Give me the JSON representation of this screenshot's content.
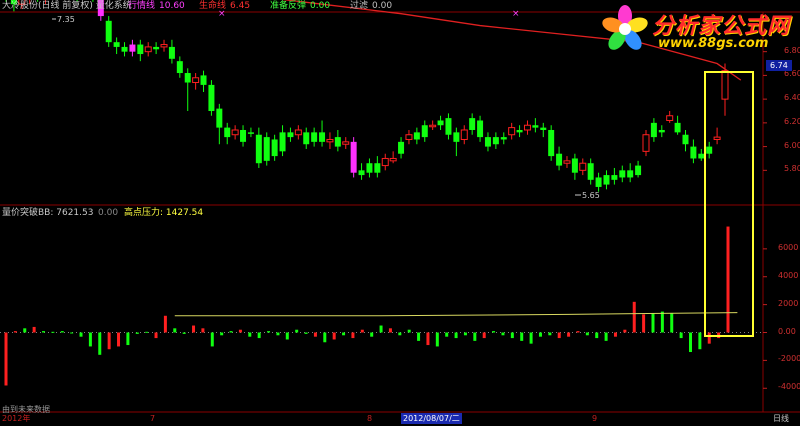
{
  "header": {
    "title": "大冷股份(日线 前复权) 量化系统",
    "items": [
      {
        "label": "行情线",
        "value": "10.60",
        "color": "#ff40ff"
      },
      {
        "label": "生命线",
        "value": "6.45",
        "color": "#ff3030"
      },
      {
        "label": "准备反弹",
        "value": "0.00",
        "color": "#40ff40"
      },
      {
        "label": "过滤",
        "value": "0.00",
        "color": "#c0c0c0"
      }
    ]
  },
  "price_panel": {
    "price_tag": "6.74",
    "y_ticks": [
      "6.80",
      "6.60",
      "6.40",
      "6.20",
      "6.00",
      "5.80"
    ],
    "high_marker": "7.35",
    "low_marker": "5.65"
  },
  "volume_panel": {
    "title": "量价突破",
    "bb_label": "BB: 7621.53",
    "bb_extra": "0.00",
    "pressure_label": "高点压力: 1427.54",
    "y_ticks": [
      "6000",
      "4000",
      "2000",
      "0.00",
      "-2000",
      "-4000"
    ],
    "footer_note": "由到未来数据"
  },
  "bottom_bar": {
    "dates": [
      "2012年",
      "7",
      "8",
      "2012/08/07/二",
      "9"
    ],
    "period": "日线"
  },
  "logo": {
    "title": "分析家公式网",
    "url": "www.88gs.com"
  },
  "colors": {
    "up": "#ff2020",
    "down": "#10ff10",
    "signal": "#ff30ff",
    "life_line": "#e02020",
    "pressure_line": "#d8d860",
    "highlight_box": "#ffff30",
    "grid": "#8a0000"
  },
  "chart_data": {
    "type": "candlestick",
    "ylim": [
      5.55,
      7.05
    ],
    "candles": [
      [
        7.32,
        7.28,
        7.36,
        7.22,
        "d"
      ],
      [
        7.26,
        7.2,
        7.3,
        7.14,
        "d"
      ],
      [
        7.2,
        7.26,
        7.3,
        7.16,
        "u"
      ],
      [
        7.24,
        7.32,
        7.36,
        7.2,
        "u"
      ],
      [
        7.3,
        7.26,
        7.35,
        7.22,
        "d"
      ],
      [
        7.26,
        7.32,
        7.35,
        7.2,
        "u"
      ],
      [
        7.36,
        7.4,
        7.42,
        7.3,
        "d"
      ],
      [
        7.38,
        7.28,
        7.42,
        7.24,
        "d"
      ],
      [
        7.28,
        7.34,
        7.38,
        7.24,
        "u"
      ],
      [
        7.34,
        7.28,
        7.38,
        7.22,
        "d"
      ],
      [
        7.3,
        7.36,
        7.4,
        7.26,
        "u"
      ],
      [
        7.36,
        7.28,
        7.4,
        7.22,
        "d"
      ],
      [
        7.28,
        7.1,
        7.32,
        7.06,
        "s"
      ],
      [
        7.06,
        6.88,
        7.1,
        6.84,
        "d"
      ],
      [
        6.88,
        6.84,
        6.92,
        6.78,
        "d"
      ],
      [
        6.84,
        6.8,
        6.88,
        6.76,
        "d"
      ],
      [
        6.8,
        6.86,
        6.9,
        6.76,
        "s"
      ],
      [
        6.86,
        6.78,
        6.9,
        6.72,
        "d"
      ],
      [
        6.8,
        6.84,
        6.88,
        6.76,
        "u"
      ],
      [
        6.84,
        6.82,
        6.88,
        6.78,
        "d"
      ],
      [
        6.84,
        6.86,
        6.9,
        6.8,
        "u"
      ],
      [
        6.84,
        6.74,
        6.9,
        6.7,
        "d"
      ],
      [
        6.72,
        6.62,
        6.76,
        6.58,
        "d"
      ],
      [
        6.62,
        6.54,
        6.66,
        6.3,
        "d"
      ],
      [
        6.54,
        6.58,
        6.62,
        6.48,
        "u"
      ],
      [
        6.6,
        6.52,
        6.64,
        6.46,
        "d"
      ],
      [
        6.52,
        6.3,
        6.56,
        6.26,
        "d"
      ],
      [
        6.32,
        6.16,
        6.36,
        6.02,
        "d"
      ],
      [
        6.16,
        6.08,
        6.2,
        6.02,
        "d"
      ],
      [
        6.1,
        6.14,
        6.18,
        6.06,
        "u"
      ],
      [
        6.14,
        6.04,
        6.18,
        6.0,
        "d"
      ],
      [
        6.12,
        6.12,
        6.16,
        6.08,
        "d"
      ],
      [
        6.1,
        5.86,
        6.16,
        5.82,
        "d"
      ],
      [
        5.88,
        6.08,
        6.12,
        5.84,
        "d"
      ],
      [
        6.06,
        5.92,
        6.1,
        5.88,
        "d"
      ],
      [
        5.96,
        6.12,
        6.18,
        5.92,
        "d"
      ],
      [
        6.12,
        6.08,
        6.16,
        6.04,
        "d"
      ],
      [
        6.1,
        6.14,
        6.18,
        6.06,
        "u"
      ],
      [
        6.12,
        6.02,
        6.16,
        5.98,
        "d"
      ],
      [
        6.04,
        6.12,
        6.16,
        6.0,
        "d"
      ],
      [
        6.12,
        6.04,
        6.22,
        6.0,
        "d"
      ],
      [
        6.04,
        6.06,
        6.12,
        5.98,
        "u"
      ],
      [
        6.08,
        6.0,
        6.14,
        5.96,
        "d"
      ],
      [
        6.02,
        6.04,
        6.08,
        5.98,
        "u"
      ],
      [
        6.04,
        5.78,
        6.08,
        5.74,
        "s"
      ],
      [
        5.8,
        5.76,
        5.86,
        5.72,
        "d"
      ],
      [
        5.78,
        5.86,
        5.9,
        5.74,
        "d"
      ],
      [
        5.86,
        5.78,
        5.92,
        5.74,
        "d"
      ],
      [
        5.84,
        5.9,
        5.94,
        5.8,
        "u"
      ],
      [
        5.9,
        5.88,
        5.96,
        5.86,
        "u"
      ],
      [
        5.94,
        6.04,
        6.08,
        5.9,
        "d"
      ],
      [
        6.06,
        6.1,
        6.14,
        6.02,
        "u"
      ],
      [
        6.12,
        6.06,
        6.16,
        6.02,
        "d"
      ],
      [
        6.08,
        6.18,
        6.22,
        6.04,
        "d"
      ],
      [
        6.18,
        6.18,
        6.22,
        6.14,
        "u"
      ],
      [
        6.18,
        6.22,
        6.26,
        6.14,
        "d"
      ],
      [
        6.24,
        6.1,
        6.28,
        6.06,
        "d"
      ],
      [
        6.12,
        6.04,
        6.16,
        5.92,
        "d"
      ],
      [
        6.06,
        6.14,
        6.18,
        6.02,
        "u"
      ],
      [
        6.14,
        6.24,
        6.28,
        6.1,
        "d"
      ],
      [
        6.22,
        6.08,
        6.26,
        6.04,
        "d"
      ],
      [
        6.08,
        6.0,
        6.12,
        5.96,
        "d"
      ],
      [
        6.02,
        6.08,
        6.12,
        5.98,
        "d"
      ],
      [
        6.08,
        6.06,
        6.12,
        6.02,
        "d"
      ],
      [
        6.1,
        6.16,
        6.2,
        6.06,
        "u"
      ],
      [
        6.14,
        6.12,
        6.18,
        6.08,
        "d"
      ],
      [
        6.14,
        6.18,
        6.22,
        6.1,
        "u"
      ],
      [
        6.18,
        6.16,
        6.24,
        6.12,
        "d"
      ],
      [
        6.16,
        6.14,
        6.2,
        6.08,
        "d"
      ],
      [
        6.14,
        5.92,
        6.18,
        5.88,
        "d"
      ],
      [
        5.94,
        5.84,
        6.0,
        5.8,
        "d"
      ],
      [
        5.86,
        5.88,
        5.92,
        5.82,
        "u"
      ],
      [
        5.9,
        5.78,
        5.94,
        5.72,
        "d"
      ],
      [
        5.8,
        5.86,
        5.9,
        5.76,
        "u"
      ],
      [
        5.86,
        5.72,
        5.9,
        5.68,
        "d"
      ],
      [
        5.74,
        5.66,
        5.78,
        5.62,
        "d"
      ],
      [
        5.68,
        5.76,
        5.8,
        5.64,
        "d"
      ],
      [
        5.76,
        5.72,
        5.82,
        5.68,
        "d"
      ],
      [
        5.74,
        5.8,
        5.84,
        5.7,
        "d"
      ],
      [
        5.8,
        5.74,
        5.86,
        5.7,
        "d"
      ],
      [
        5.76,
        5.84,
        5.88,
        5.74,
        "d"
      ],
      [
        5.96,
        6.1,
        6.14,
        5.92,
        "u"
      ],
      [
        6.08,
        6.2,
        6.24,
        6.04,
        "d"
      ],
      [
        6.14,
        6.12,
        6.18,
        6.08,
        "d"
      ],
      [
        6.22,
        6.26,
        6.3,
        6.2,
        "u"
      ],
      [
        6.2,
        6.12,
        6.26,
        6.1,
        "d"
      ],
      [
        6.1,
        6.02,
        6.14,
        5.96,
        "d"
      ],
      [
        6.0,
        5.9,
        6.06,
        5.86,
        "d"
      ],
      [
        5.9,
        5.94,
        5.98,
        5.88,
        "d"
      ],
      [
        5.94,
        6.0,
        6.04,
        5.9,
        "d"
      ],
      [
        6.06,
        6.08,
        6.16,
        6.02,
        "u"
      ],
      [
        6.4,
        6.64,
        6.7,
        6.26,
        "u"
      ]
    ],
    "life_line": [
      [
        0,
        7.6
      ],
      [
        10,
        7.48
      ],
      [
        20,
        7.38
      ],
      [
        30,
        7.28
      ],
      [
        40,
        7.2
      ],
      [
        50,
        7.12
      ],
      [
        60,
        7.02
      ],
      [
        70,
        6.95
      ],
      [
        80,
        6.88
      ],
      [
        90,
        6.7
      ],
      [
        93,
        6.56
      ]
    ],
    "volume": [
      [
        -3800,
        "u"
      ],
      [
        100,
        "u"
      ],
      [
        300,
        "d"
      ],
      [
        400,
        "u"
      ],
      [
        100,
        "d"
      ],
      [
        50,
        "d"
      ],
      [
        100,
        "d"
      ],
      [
        -50,
        "d"
      ],
      [
        -300,
        "d"
      ],
      [
        -1000,
        "d"
      ],
      [
        -1600,
        "d"
      ],
      [
        -1200,
        "u"
      ],
      [
        -1000,
        "u"
      ],
      [
        -900,
        "d"
      ],
      [
        -100,
        "d"
      ],
      [
        50,
        "d"
      ],
      [
        -400,
        "u"
      ],
      [
        1200,
        "u"
      ],
      [
        300,
        "d"
      ],
      [
        -100,
        "d"
      ],
      [
        500,
        "u"
      ],
      [
        300,
        "u"
      ],
      [
        -1000,
        "d"
      ],
      [
        -200,
        "d"
      ],
      [
        100,
        "d"
      ],
      [
        200,
        "u"
      ],
      [
        -300,
        "d"
      ],
      [
        -400,
        "d"
      ],
      [
        100,
        "d"
      ],
      [
        -200,
        "d"
      ],
      [
        -500,
        "d"
      ],
      [
        200,
        "d"
      ],
      [
        -100,
        "d"
      ],
      [
        -300,
        "u"
      ],
      [
        -700,
        "d"
      ],
      [
        -500,
        "u"
      ],
      [
        -200,
        "d"
      ],
      [
        -400,
        "u"
      ],
      [
        200,
        "u"
      ],
      [
        -300,
        "d"
      ],
      [
        500,
        "d"
      ],
      [
        300,
        "u"
      ],
      [
        -200,
        "d"
      ],
      [
        200,
        "d"
      ],
      [
        -600,
        "d"
      ],
      [
        -900,
        "u"
      ],
      [
        -1000,
        "d"
      ],
      [
        -300,
        "d"
      ],
      [
        -400,
        "d"
      ],
      [
        -200,
        "d"
      ],
      [
        -600,
        "d"
      ],
      [
        -400,
        "u"
      ],
      [
        100,
        "d"
      ],
      [
        -200,
        "d"
      ],
      [
        -400,
        "d"
      ],
      [
        -600,
        "d"
      ],
      [
        -800,
        "d"
      ],
      [
        -300,
        "d"
      ],
      [
        -200,
        "d"
      ],
      [
        -400,
        "u"
      ],
      [
        -300,
        "u"
      ],
      [
        100,
        "u"
      ],
      [
        -200,
        "d"
      ],
      [
        -400,
        "d"
      ],
      [
        -600,
        "d"
      ],
      [
        -300,
        "u"
      ],
      [
        200,
        "u"
      ],
      [
        2200,
        "u"
      ],
      [
        1300,
        "u"
      ],
      [
        1400,
        "d"
      ],
      [
        1500,
        "d"
      ],
      [
        1400,
        "d"
      ],
      [
        -400,
        "d"
      ],
      [
        -1400,
        "d"
      ],
      [
        -1200,
        "d"
      ],
      [
        -800,
        "u"
      ],
      [
        -400,
        "u"
      ],
      [
        7600,
        "u"
      ]
    ],
    "pressure_line": [
      [
        18,
        1200
      ],
      [
        40,
        1200
      ],
      [
        60,
        1300
      ],
      [
        78,
        1427.54
      ]
    ]
  }
}
